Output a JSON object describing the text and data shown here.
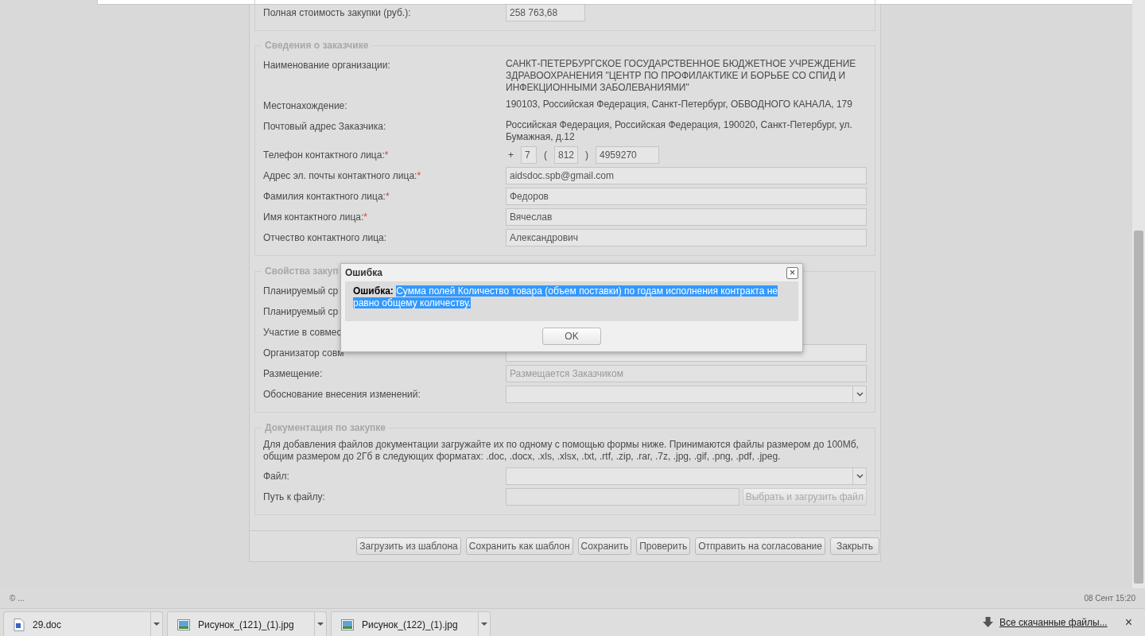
{
  "sections": [
    {
      "kind": "cut",
      "rows": [
        {
          "kind": "short",
          "label": "Полная стоимость закупки (руб.):",
          "value": "258 763,68",
          "disabled": false
        }
      ]
    },
    {
      "kind": "fieldset",
      "legend": "Сведения о заказчике",
      "rows": [
        {
          "kind": "text",
          "label": "Наименование организации:",
          "value": "САНКТ-ПЕТЕРБУРГСКОЕ ГОСУДАРСТВЕННОЕ БЮДЖЕТНОЕ УЧРЕЖДЕНИЕ ЗДРАВООХРАНЕНИЯ \"ЦЕНТР ПО ПРОФИЛАКТИКЕ И БОРЬБЕ СО СПИД И ИНФЕКЦИОННЫМИ ЗАБОЛЕВАНИЯМИ\""
        },
        {
          "kind": "text",
          "label": "Местонахождение:",
          "value": "190103, Российская Федерация, Санкт-Петербург, ОБВОДНОГО КАНАЛА, 179"
        },
        {
          "kind": "text",
          "label": "Почтовый адрес Заказчика:",
          "value": "Российская Федерация, Российская Федерация, 190020, Санкт-Петербург, ул. Бумажная, д.12"
        },
        {
          "kind": "phone",
          "label": "Телефон контактного лица:",
          "required_mark": "*",
          "plus": "+",
          "country": "7",
          "open": "(",
          "code": "812",
          "close": ")",
          "number": "4959270"
        },
        {
          "kind": "field",
          "label": "Адрес эл. почты контактного лица:",
          "required_mark": "*",
          "value": "aidsdoc.spb@gmail.com",
          "disabled": false
        },
        {
          "kind": "field",
          "label": "Фамилия контактного лица:",
          "required_mark": "*",
          "value": "Федоров",
          "disabled": false
        },
        {
          "kind": "field",
          "label": "Имя контактного лица:",
          "required_mark": "*",
          "value": "Вячеслав",
          "disabled": false
        },
        {
          "kind": "field",
          "label": "Отчество контактного лица:",
          "value": "Александрович",
          "disabled": false
        }
      ]
    },
    {
      "kind": "fieldset",
      "legend": "Свойства закуп",
      "rows": [
        {
          "kind": "label",
          "label": "Планируемый ср"
        },
        {
          "kind": "label",
          "label": "Планируемый ср"
        },
        {
          "kind": "label",
          "label": "Участие в совмес"
        },
        {
          "kind": "field",
          "label": "Организатор совм"
        },
        {
          "kind": "field",
          "label": "Размещение:",
          "value": "Размещается Заказчиком",
          "disabled": true
        },
        {
          "kind": "select",
          "label": "Обоснование внесения изменений:"
        }
      ]
    },
    {
      "kind": "fieldset",
      "legend": "Документация по закупке",
      "note": "Для добавления файлов документации загружайте их по одному с помощью формы ниже. Принимаются файлы размером до 100Мб, общим размером до 2Гб в следующих форматах: .doc, .docx, .xls, .xlsx, .txt, .rtf, .zip, .rar, .7z, .jpg, .gif, .png, .pdf, .jpeg.",
      "rows": [
        {
          "kind": "select",
          "label": "Файл:"
        },
        {
          "kind": "upload",
          "label": "Путь к файлу:",
          "button": "Выбрать и загрузить файл",
          "disabled": true
        }
      ]
    }
  ],
  "buttons": [
    "Загрузить из шаблона",
    "Сохранить как шаблон",
    "Сохранить",
    "Проверить",
    "Отправить на согласование",
    "Закрыть"
  ],
  "dialog": {
    "title": "Ошибка",
    "close": "×",
    "label": "Ошибка:",
    "message": "Сумма полей Количество товара (объем поставки) по годам исполнения контракта не равно общему количеству.",
    "highlighted": true,
    "button": "OK"
  },
  "status_bar": {
    "left": "© ...",
    "right": "08 Сент 15:20"
  },
  "downloads": {
    "items": [
      {
        "name": "29.doc",
        "kind": "doc"
      },
      {
        "name": "Рисунок_(121)_(1).jpg",
        "kind": "image"
      },
      {
        "name": "Рисунок_(122)_(1).jpg",
        "kind": "image"
      }
    ],
    "all": "Все скачанные файлы...",
    "close": "×"
  }
}
